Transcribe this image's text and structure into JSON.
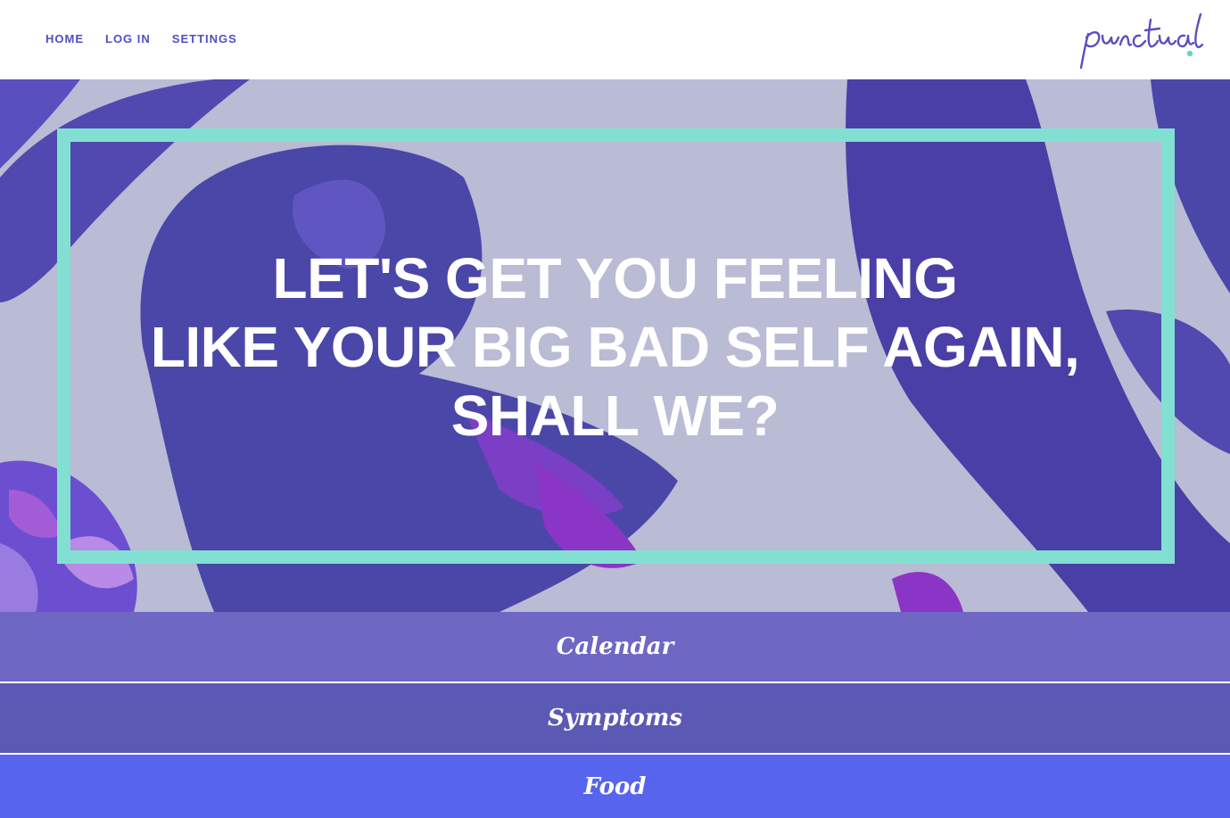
{
  "nav": {
    "home": "HOME",
    "login": "LOG IN",
    "settings": "SETTINGS"
  },
  "logo": {
    "text": "punctual",
    "color": "#5a4fc0",
    "dot_color": "#5fd6c3"
  },
  "hero": {
    "line1": "LET'S GET YOU FEELING",
    "line2": "LIKE YOUR BIG BAD SELF AGAIN,",
    "line3": "SHALL WE?",
    "frame_color": "#82e0d2",
    "bg_color": "#babbd4",
    "leaf_color": "#4a47a8"
  },
  "menu": {
    "calendar": "Calendar",
    "symptoms": "Symptoms",
    "food": "Food"
  },
  "colors": {
    "calendar_bg": "#6f67c4",
    "symptoms_bg": "#5c59b5",
    "food_bg": "#5764ee",
    "nav_text": "#4e4fc4"
  }
}
